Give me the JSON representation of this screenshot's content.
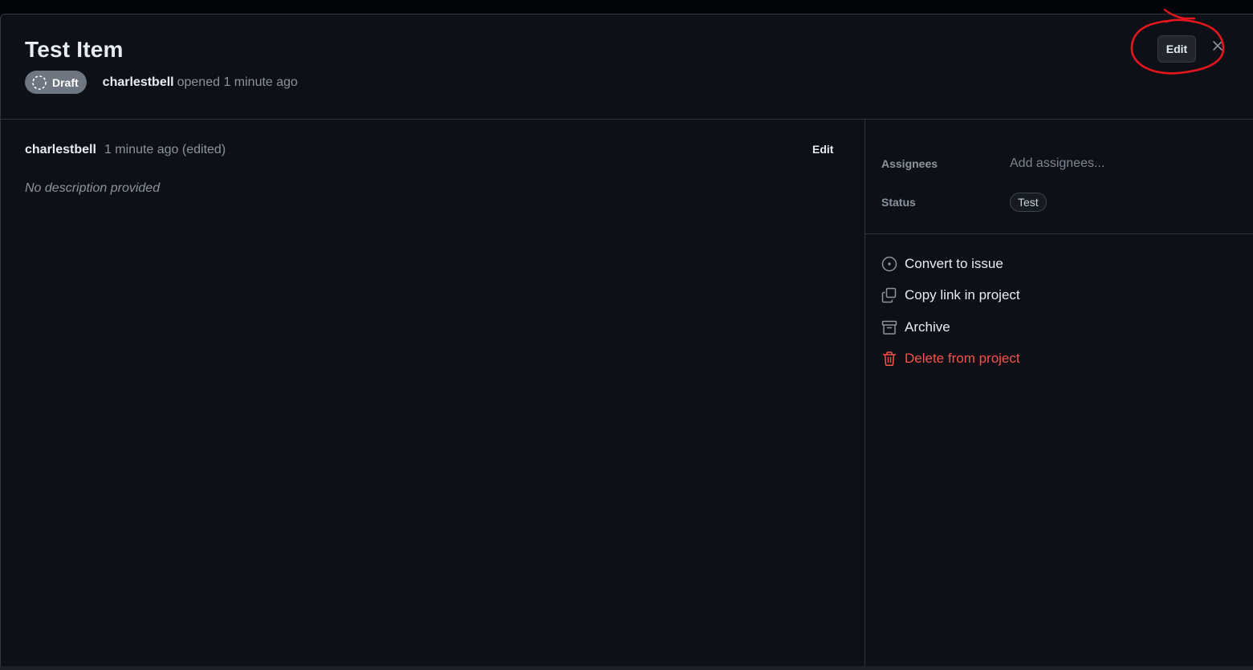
{
  "item": {
    "title": "Test Item",
    "state_badge": "Draft",
    "author": "charlestbell",
    "opened_text": "opened 1 minute ago"
  },
  "header_actions": {
    "edit_label": "Edit",
    "close_icon": "close-icon",
    "annotation_color": "#e5161d"
  },
  "comment": {
    "author": "charlestbell",
    "time_text": "1 minute ago (edited)",
    "edit_label": "Edit",
    "body": "No description provided"
  },
  "fields": {
    "assignees": {
      "label": "Assignees",
      "placeholder": "Add assignees..."
    },
    "status": {
      "label": "Status",
      "value": "Test"
    }
  },
  "actions": [
    {
      "label": "Convert to issue",
      "icon": "issue-opened-icon"
    },
    {
      "label": "Copy link in project",
      "icon": "copy-icon"
    },
    {
      "label": "Archive",
      "icon": "archive-icon"
    },
    {
      "label": "Delete from project",
      "icon": "trash-icon",
      "danger": true
    }
  ],
  "colors": {
    "background": "#0d1117",
    "border": "#30363d",
    "muted_text": "#8b949e",
    "danger": "#f85149",
    "draft_badge": "#6e7681"
  }
}
